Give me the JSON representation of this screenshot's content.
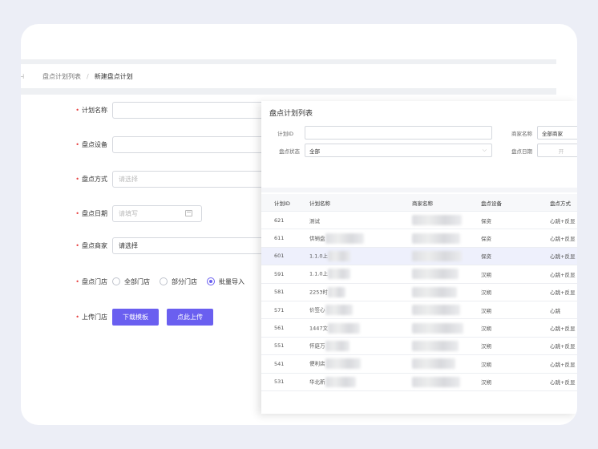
{
  "breadcrumb": {
    "back_icon": "collapse-icon",
    "parent": "盘点计划列表",
    "separator": "/",
    "current": "新建盘点计划"
  },
  "form": {
    "plan_name_label": "计划名称",
    "device_label": "盘点设备",
    "method_label": "盘点方式",
    "method_placeholder": "请选择",
    "date_label": "盘点日期",
    "date_placeholder": "请填写",
    "merchant_label": "盘点商家",
    "merchant_value": "请选择",
    "store_label": "盘点门店",
    "store_options": [
      {
        "label": "全部门店",
        "selected": false
      },
      {
        "label": "部分门店",
        "selected": false
      },
      {
        "label": "批量导入",
        "selected": true
      }
    ],
    "upload_label": "上传门店",
    "download_button": "下载模板",
    "upload_button": "点此上传",
    "required_mark": "•"
  },
  "panel": {
    "title": "盘点计划列表",
    "filters": {
      "plan_id_label": "计划ID",
      "plan_id_value": "",
      "status_label": "盘点状态",
      "status_value": "全部",
      "merchant_label": "商家名称",
      "merchant_value": "全部商家",
      "date_label": "盘点日期",
      "date_value": "开"
    },
    "columns": [
      "计划ID",
      "计划名称",
      "商家名称",
      "盘点设备",
      "盘点方式"
    ],
    "rows": [
      {
        "id": "621",
        "name": "测试",
        "device": "保资",
        "method": "心跳+反显",
        "selected": false
      },
      {
        "id": "611",
        "name": "供销盘",
        "device": "保资",
        "method": "心跳+反显",
        "selected": false
      },
      {
        "id": "601",
        "name": "1.1.0上",
        "device": "保资",
        "method": "心跳+反显",
        "selected": true
      },
      {
        "id": "591",
        "name": "1.1.0上",
        "device": "汉朔",
        "method": "心跳+反显",
        "selected": false
      },
      {
        "id": "581",
        "name": "2253时",
        "device": "汉朔",
        "method": "心跳+反显",
        "selected": false
      },
      {
        "id": "571",
        "name": "价签心",
        "device": "汉朔",
        "method": "心跳",
        "selected": false
      },
      {
        "id": "561",
        "name": "1447文",
        "device": "汉朔",
        "method": "心跳+反显",
        "selected": false
      },
      {
        "id": "551",
        "name": "怀庭万",
        "device": "汉朔",
        "method": "心跳+反显",
        "selected": false
      },
      {
        "id": "541",
        "name": "便利店",
        "device": "汉朔",
        "method": "心跳+反显",
        "selected": false
      },
      {
        "id": "531",
        "name": "华北新",
        "device": "汉朔",
        "method": "心跳+反显",
        "selected": false
      }
    ]
  },
  "colors": {
    "accent": "#6a5ff0",
    "required": "#e84141",
    "selected_row": "#eef0fc"
  }
}
